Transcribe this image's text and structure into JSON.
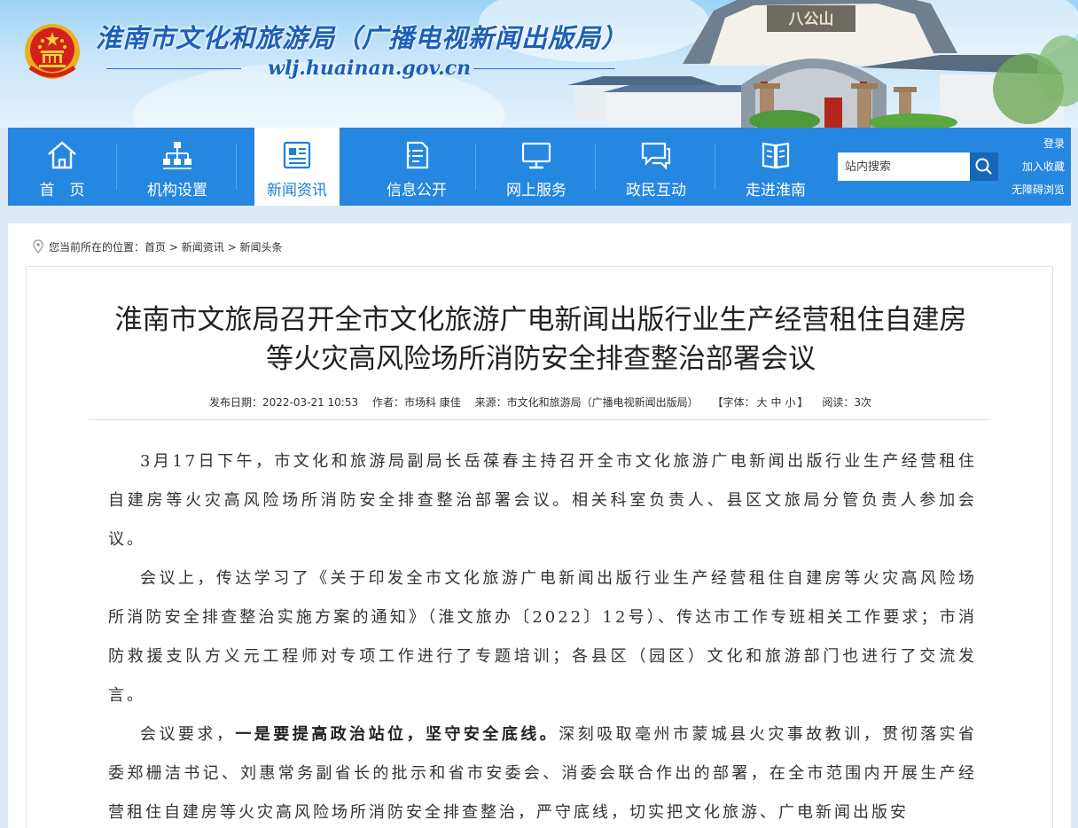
{
  "header": {
    "site_title": "淮南市文化和旅游局（广播电视新闻出版局）",
    "site_url": "wlj.huainan.gov.cn",
    "gate_sign": "八公山"
  },
  "nav": {
    "items": [
      {
        "label": "首　页",
        "icon": "home-icon"
      },
      {
        "label": "机构设置",
        "icon": "org-chart-icon"
      },
      {
        "label": "新闻资讯",
        "icon": "newspaper-icon"
      },
      {
        "label": "信息公开",
        "icon": "document-icon"
      },
      {
        "label": "网上服务",
        "icon": "monitor-icon"
      },
      {
        "label": "政民互动",
        "icon": "chat-icon"
      },
      {
        "label": "走进淮南",
        "icon": "book-icon"
      }
    ],
    "active_index": 2,
    "search_placeholder": "站内搜索",
    "links": {
      "login": "登录",
      "favorite": "加入收藏",
      "accessible": "无障碍浏览"
    }
  },
  "breadcrumb": {
    "prefix": "您当前所在的位置：",
    "home": "首页",
    "sep": ">",
    "section": "新闻资讯",
    "current": "新闻头条"
  },
  "article": {
    "title_line1": "淮南市文旅局召开全市文化旅游广电新闻出版行业生产经营租住自建房",
    "title_line2": "等火灾高风险场所消防安全排查整治部署会议",
    "meta": {
      "date": "发布日期：2022-03-21 10:53",
      "author": "作者：市场科 康佳",
      "source": "来源：市文化和旅游局（广播电视新闻出版局）",
      "font_prefix": "【字体：",
      "font_large": "大",
      "font_medium": "中",
      "font_small": "小",
      "font_suffix": "】",
      "views": "阅读：3次"
    },
    "p1": "3月17日下午，市文化和旅游局副局长岳葆春主持召开全市文化旅游广电新闻出版行业生产经营租住自建房等火灾高风险场所消防安全排查整治部署会议。相关科室负责人、县区文旅局分管负责人参加会议。",
    "p2": "会议上，传达学习了《关于印发全市文化旅游广电新闻出版行业生产经营租住自建房等火灾高风险场所消防安全排查整治实施方案的通知》（淮文旅办〔2022〕12号）、传达市工作专班相关工作要求；市消防救援支队方义元工程师对专项工作进行了专题培训；各县区（园区）文化和旅游部门也进行了交流发言。",
    "p3_lead": "会议要求，",
    "p3_bold": "一是要提高政治站位，坚守安全底线。",
    "p3_rest": "深刻吸取亳州市蒙城县火灾事故教训，贯彻落实省委郑栅洁书记、刘惠常务副省长的批示和省市安委会、消委会联合作出的部署，在全市范围内开展生产经营租住自建房等火灾高风险场所消防安全排查整治，严守底线，切实把文化旅游、广电新闻出版安"
  },
  "colors": {
    "nav_bg": "#2587e0",
    "nav_active_text": "#1e7fd6",
    "page_bg": "#dde9f6",
    "title_blue": "#1d5fb8"
  }
}
